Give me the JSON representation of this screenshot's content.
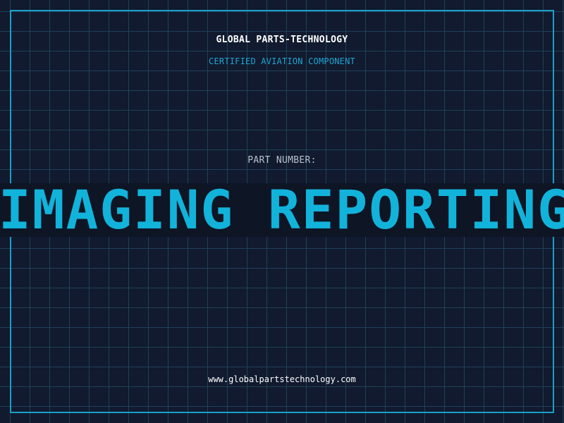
{
  "label": {
    "company": "GLOBAL PARTS-TECHNOLOGY",
    "subtitle": "CERTIFIED AVIATION COMPONENT",
    "part_number_label": "PART NUMBER:",
    "part_number_value": "IMAGING REPORTING AND",
    "website": "www.globalpartstechnology.com"
  },
  "colors": {
    "background": "#111a2e",
    "grid": "#1f4259",
    "frame": "#1b9ec9",
    "accent": "#12b3db"
  }
}
